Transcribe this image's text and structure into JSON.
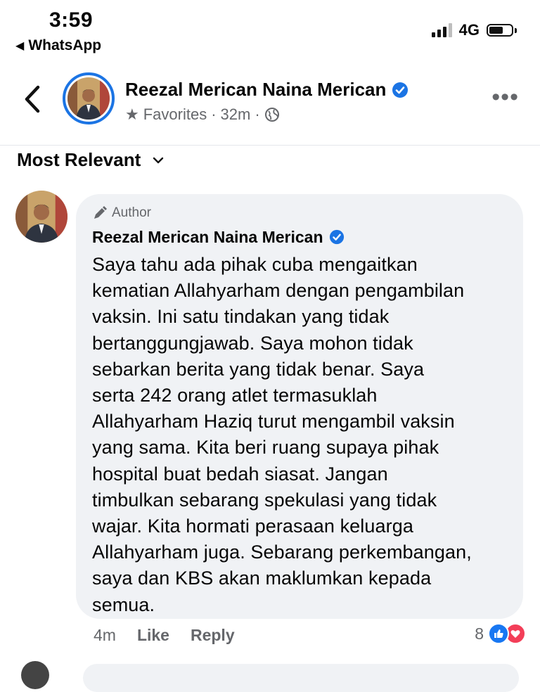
{
  "status_bar": {
    "time": "3:59",
    "back_app": "WhatsApp",
    "network": "4G"
  },
  "header": {
    "page_name": "Reezal Merican Naina Merican",
    "favorites": "Favorites",
    "time_ago": "32m",
    "separator": "·"
  },
  "sort": {
    "label": "Most Relevant"
  },
  "comment": {
    "badge": "Author",
    "author": "Reezal Merican Naina Merican",
    "text": "Saya tahu ada pihak cuba mengaitkan\nkematian Allahyarham dengan pengambilan\nvaksin. Ini satu tindakan yang tidak\nbertanggungjawab. Saya mohon tidak\nsebarkan berita yang tidak benar. Saya\nserta 242 orang atlet termasuklah\nAllahyarham Haziq turut mengambil vaksin\nyang sama. Kita beri ruang supaya pihak\nhospital buat bedah siasat. Jangan\ntimbulkan sebarang spekulasi yang tidak\nwajar. Kita hormati perasaan keluarga\nAllahyarham juga. Sebarang perkembangan,\nsaya dan KBS akan maklumkan kepada\nsemua.",
    "time_ago": "4m",
    "like_label": "Like",
    "reply_label": "Reply",
    "reaction_count": "8"
  },
  "colors": {
    "accent": "#1b74e4",
    "bubble": "#f0f2f5",
    "secondary_text": "#65676b",
    "like": "#1877f2",
    "love": "#f33e58"
  },
  "icons": [
    "back-arrow-icon",
    "verified-badge-icon",
    "star-icon",
    "globe-icon",
    "more-icon",
    "chevron-down-icon",
    "pen-icon",
    "like-reaction-icon",
    "love-reaction-icon"
  ]
}
